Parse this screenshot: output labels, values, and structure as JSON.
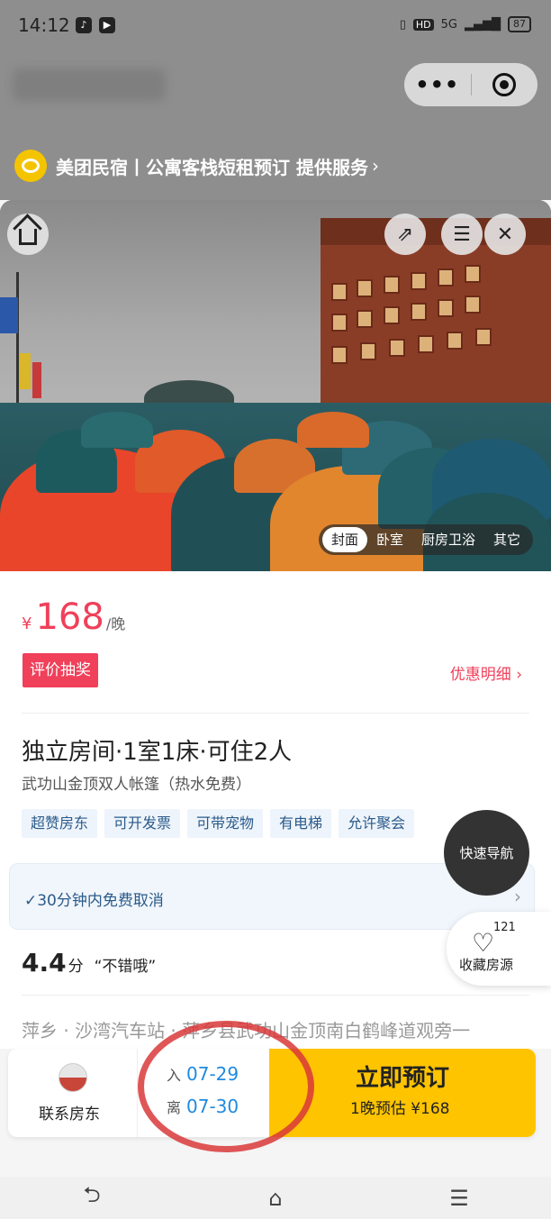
{
  "status_bar": {
    "time": "14:12",
    "network": "5G",
    "hd": "HD",
    "battery": "87"
  },
  "capsule": {
    "more_icon": "more-dots-icon",
    "close_icon": "target-icon"
  },
  "provider": {
    "text": "美团民宿丨公寓客栈短租预订 提供服务",
    "chevron": "›"
  },
  "photo": {
    "tabs": [
      "封面",
      "卧室",
      "厨房卫浴",
      "其它"
    ],
    "active_tab": "封面"
  },
  "price": {
    "currency": "¥",
    "value": "168",
    "unit": "/晚"
  },
  "review_badge": "评价抽奖",
  "discount_link": "优惠明细 ›",
  "room": {
    "title": "独立房间·1室1床·可住2人",
    "subtitle": "武功山金顶双人帐篷（热水免费）",
    "tags": [
      "超赞房东",
      "可开发票",
      "可带宠物",
      "有电梯",
      "允许聚会"
    ]
  },
  "cancel_policy": "✓30分钟内免费取消",
  "rating": {
    "value": "4.4",
    "unit": "分",
    "quote": "“不错哦”"
  },
  "address": "萍乡 · 沙湾汽车站 · 萍乡县武功山金顶南白鹤峰道观旁一",
  "quick_nav": "快速导航",
  "favorite": {
    "count": "121",
    "label": "收藏房源"
  },
  "bottom_bar": {
    "contact_label": "联系房东",
    "checkin_key": "入",
    "checkin_date": "07-29",
    "checkout_key": "离",
    "checkout_date": "07-30",
    "book_label": "立即预订",
    "book_sub": "1晚预估 ¥168"
  },
  "nav_bar": {
    "back": "⮌",
    "home": "⌂",
    "menu": "☰"
  }
}
